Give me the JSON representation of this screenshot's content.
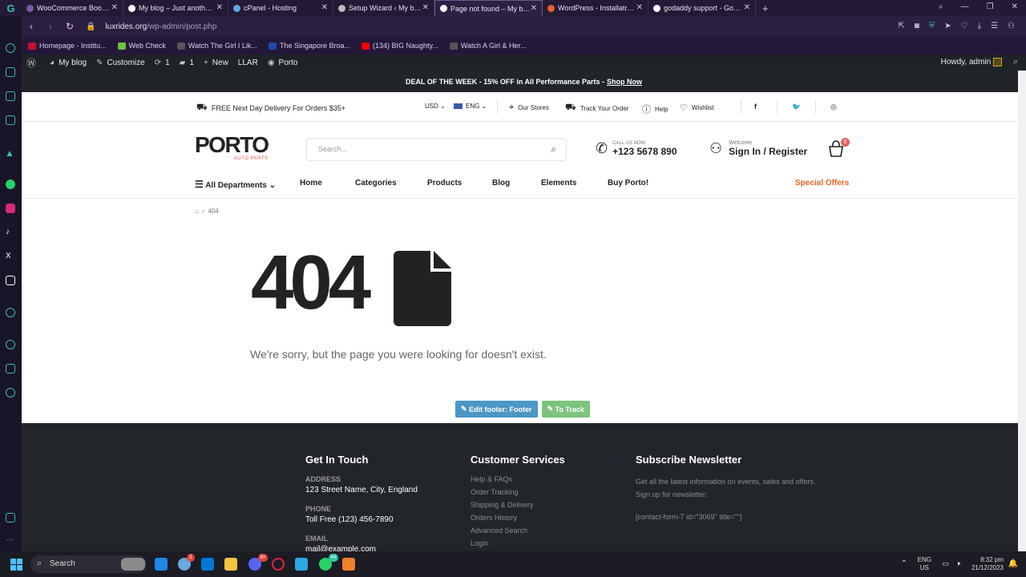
{
  "tabs": [
    {
      "label": "WooCommerce Bookings",
      "color": "#7f54b3"
    },
    {
      "label": "My blog – Just another W",
      "color": "#ffffff"
    },
    {
      "label": "cPanel - Hosting",
      "color": "#5aa9e6"
    },
    {
      "label": "Setup Wizard ‹ My blog —",
      "color": "#bbbbbb"
    },
    {
      "label": "Page not found – My blog",
      "color": "#ffffff",
      "active": true
    },
    {
      "label": "WordPress - Installatron A",
      "color": "#e8622b"
    },
    {
      "label": "godaddy support - Google",
      "color": "#ffffff"
    }
  ],
  "newtab": "+",
  "url": {
    "host": "luxrides.org",
    "path": "/wp-admin/post.php"
  },
  "bookmarks": [
    {
      "label": "Homepage - Institu...",
      "color": "#c8102e"
    },
    {
      "label": "Web Check",
      "color": "#6fbf3f"
    },
    {
      "label": "Watch The Girl I Lik...",
      "color": "#555555"
    },
    {
      "label": "The Singapore Broa...",
      "color": "#1f4aa8"
    },
    {
      "label": "(134) BIG Naughty...",
      "color": "#ff0000"
    },
    {
      "label": "Watch A Girl & Her...",
      "color": "#555555"
    }
  ],
  "wpbar": {
    "site": "My blog",
    "customize": "Customize",
    "updates": "1",
    "comments": "1",
    "new": "New",
    "llar": "LLAR",
    "porto": "Porto",
    "howdy": "Howdy, admin"
  },
  "deal": {
    "text": "DEAL OF THE WEEK - 15% OFF in All Performance Parts -",
    "link": "Shop Now"
  },
  "topinfo": {
    "delivery": "FREE Next Day Delivery For Orders $35+",
    "currency": "USD",
    "language": "ENG",
    "stores": "Our Stores",
    "track": "Track Your Order",
    "help": "Help",
    "wishlist": "Wishlist"
  },
  "logo": {
    "name": "PORTO",
    "sub": "AUTO PARTS"
  },
  "search": {
    "placeholder": "Search..."
  },
  "call": {
    "label": "CALL US NOW",
    "number": "+123 5678 890"
  },
  "signin": {
    "label": "Welcome",
    "text": "Sign In / Register"
  },
  "cart": {
    "count": "0"
  },
  "menu": {
    "departments": "All Departments",
    "items": [
      "Home",
      "Categories",
      "Products",
      "Blog",
      "Elements",
      "Buy Porto!"
    ],
    "special": "Special Offers"
  },
  "breadcrumb": {
    "current": "404"
  },
  "notfound": {
    "code": "404",
    "message": "We're sorry, but the page you were looking for doesn't exist."
  },
  "edit": {
    "footer": "Edit footer: Footer",
    "track": "To Track"
  },
  "footer": {
    "contact": {
      "title": "Get In Touch",
      "address_label": "ADDRESS",
      "address": "123 Street Name, City, England",
      "phone_label": "PHONE",
      "phone": "Toll Free (123) 456-7890",
      "email_label": "EMAIL",
      "email": "mail@example.com"
    },
    "services": {
      "title": "Customer Services",
      "links": [
        "Help & FAQs",
        "Order Tracking",
        "Shipping & Delivery",
        "Orders History",
        "Advanced Search",
        "Login"
      ]
    },
    "newsletter": {
      "title": "Subscribe Newsletter",
      "text": "Get all the latest information on events, sales and offers. Sign up for newsletter:",
      "shortcode": "[contact-form-7 id=\"3069\" title=\"\"]"
    }
  },
  "taskbar": {
    "search": "Search",
    "lang1": "ENG",
    "lang2": "US",
    "time": "8:32 pm",
    "date": "21/12/2023",
    "badge_chat": "9+",
    "badge_wa": "64",
    "badge_weather": "1"
  },
  "colors": {
    "accent": "#e36159",
    "special": "#e4651e",
    "edit_footer": "#4c97c5",
    "edit_track": "#7cc47f"
  }
}
